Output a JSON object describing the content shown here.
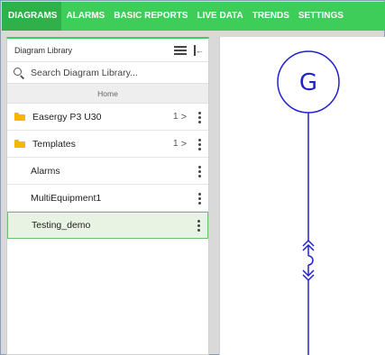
{
  "nav": {
    "tabs": [
      "DIAGRAMS",
      "ALARMS",
      "BASIC REPORTS",
      "LIVE DATA",
      "TRENDS",
      "SETTINGS"
    ],
    "active": "DIAGRAMS"
  },
  "library": {
    "title": "Diagram Library",
    "search_placeholder": "Search Diagram Library...",
    "breadcrumb": "Home",
    "folders": [
      {
        "label": "Easergy P3 U30",
        "count": "1"
      },
      {
        "label": "Templates",
        "count": "1"
      }
    ],
    "items": [
      {
        "label": "Alarms"
      },
      {
        "label": "MultiEquipment1"
      },
      {
        "label": "Testing_demo",
        "selected": true
      }
    ]
  },
  "diagram": {
    "generator_label": "G",
    "line_color": "#2222cc"
  },
  "colors": {
    "accent": "#3dcd58",
    "folder": "#f5b700"
  }
}
